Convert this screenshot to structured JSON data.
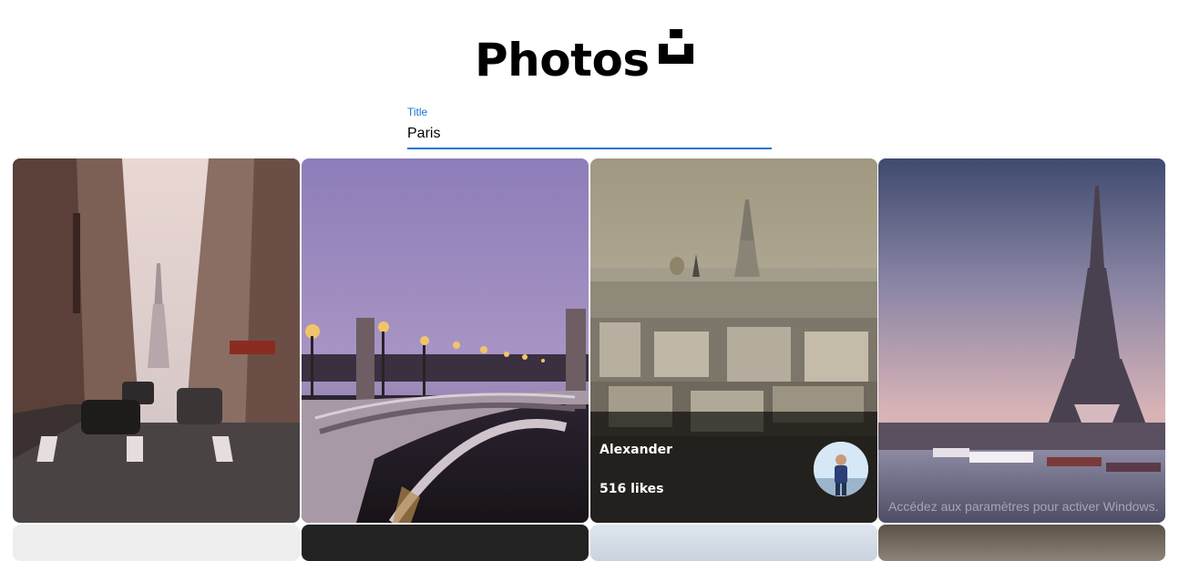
{
  "header": {
    "title": "Photos",
    "logo_icon": "unsplash-logo-icon"
  },
  "search": {
    "label": "Title",
    "value": "Paris"
  },
  "photos": [
    {
      "alt": "Paris street with Eiffel Tower"
    },
    {
      "alt": "Pont Alexandre III at dusk"
    },
    {
      "alt": "Paris rooftops and Eiffel Tower",
      "author": "Alexander",
      "likes": "516 likes",
      "hovered": true
    },
    {
      "alt": "Eiffel Tower over the Seine"
    }
  ],
  "watermark": {
    "text": "Accédez aux paramètres pour activer Windows."
  },
  "colors": {
    "accent": "#1976d2",
    "overlay": "#000000"
  }
}
